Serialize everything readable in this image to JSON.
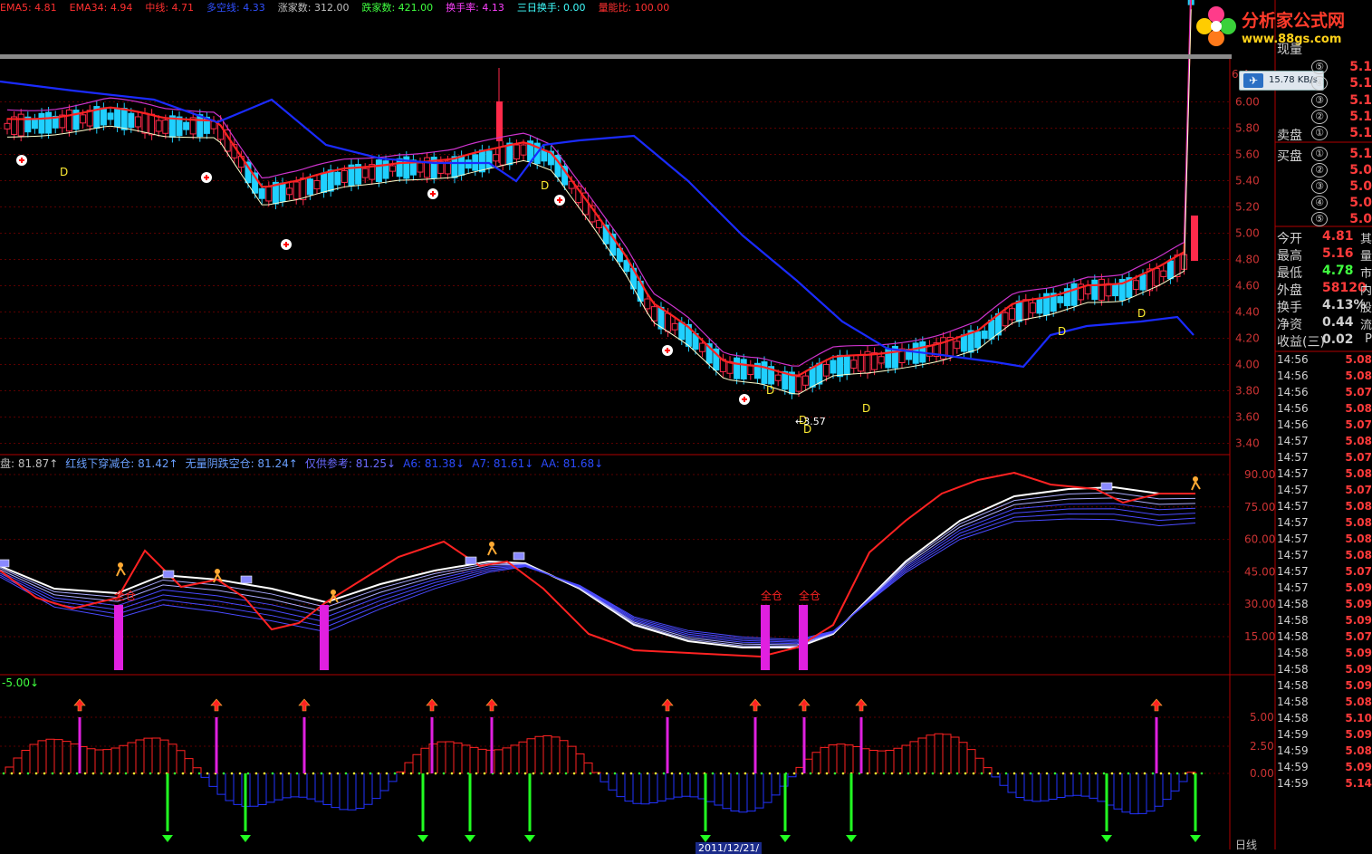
{
  "top_indicators": [
    {
      "text": "EMA5: 4.81",
      "color": "#ff3030"
    },
    {
      "text": "EMA34: 4.94",
      "color": "#ff3030"
    },
    {
      "text": "中线: 4.71",
      "color": "#ff3030"
    },
    {
      "text": "多空线: 4.33",
      "color": "#3050ff"
    },
    {
      "text": "涨家数: 312.00",
      "color": "#c0c0c0"
    },
    {
      "text": "跌家数: 421.00",
      "color": "#40ff40"
    },
    {
      "text": "换手率: 4.13",
      "color": "#ff40ff"
    },
    {
      "text": "三日换手: 0.00",
      "color": "#40ffff"
    },
    {
      "text": "量能比: 100.00",
      "color": "#ff3030"
    }
  ],
  "logo": {
    "name": "分析家公式网",
    "url": "www.88gs.com"
  },
  "speed_widget": {
    "text": "15.78 KB/s"
  },
  "price_axis": [
    "6.00",
    "5.80",
    "5.60",
    "5.40",
    "5.20",
    "5.00",
    "4.80",
    "4.60",
    "4.40",
    "4.20",
    "4.00",
    "3.80",
    "3.60",
    "3.40"
  ],
  "price_partial_label": "6.4",
  "low_label": "3.57",
  "d_marks": [
    "D",
    "D",
    "D",
    "D",
    "D",
    "D",
    "D",
    "D"
  ],
  "osc_legend": [
    {
      "text": "盘: 81.87↑",
      "color": "#c0c0c0"
    },
    {
      "text": "红线下穿减仓: 81.42↑",
      "color": "#6aa0ff"
    },
    {
      "text": "无量阴跌空仓: 81.24↑",
      "color": "#6aa0ff"
    },
    {
      "text": "仅供参考: 81.25↓",
      "color": "#6a6aff"
    },
    {
      "text": "A6: 81.38↓",
      "color": "#2b4bff"
    },
    {
      "text": "A7: 81.61↓",
      "color": "#2b4bff"
    },
    {
      "text": "AA: 81.68↓",
      "color": "#2b4bff"
    }
  ],
  "osc_axis": [
    "90.00",
    "75.00",
    "60.00",
    "45.00",
    "30.00",
    "15.00"
  ],
  "osc_bar_label": "全仓",
  "macd_label": "-5.00↓",
  "macd_axis": [
    "5.00",
    "2.50",
    "0.00"
  ],
  "date_label": "2011/12/21/",
  "bottom_label": "日线",
  "quote_panel": {
    "header": "现量",
    "sell_label": "卖盘",
    "buy_label": "买盘",
    "levels_sell": [
      "⑤",
      "④",
      "③",
      "②",
      "①"
    ],
    "levels_buy": [
      "①",
      "②",
      "③",
      "④",
      "⑤"
    ],
    "sell_vals": [
      "5.1",
      "5.1",
      "5.1",
      "5.1",
      "5.1"
    ],
    "buy_vals": [
      "5.1",
      "5.0",
      "5.0",
      "5.0",
      "5.0"
    ],
    "stats": [
      {
        "k": "今开",
        "v": "4.81",
        "c": "#ff3b3b",
        "x": "其"
      },
      {
        "k": "最高",
        "v": "5.16",
        "c": "#ff3b3b",
        "x": "量"
      },
      {
        "k": "最低",
        "v": "4.78",
        "c": "#40ff40",
        "x": "市"
      },
      {
        "k": "外盘",
        "v": "58120",
        "c": "#ff3b3b",
        "x": "内"
      },
      {
        "k": "换手",
        "v": "4.13%",
        "c": "#d0d0d0",
        "x": "股"
      },
      {
        "k": "净资",
        "v": "0.44",
        "c": "#d0d0d0",
        "x": "流"
      },
      {
        "k": "收益(三)",
        "v": "0.02",
        "c": "#d0d0d0",
        "x": "P"
      }
    ],
    "ticks": [
      {
        "t": "14:56",
        "v": "5.08"
      },
      {
        "t": "14:56",
        "v": "5.08"
      },
      {
        "t": "14:56",
        "v": "5.07"
      },
      {
        "t": "14:56",
        "v": "5.08"
      },
      {
        "t": "14:56",
        "v": "5.07"
      },
      {
        "t": "14:57",
        "v": "5.08"
      },
      {
        "t": "14:57",
        "v": "5.07"
      },
      {
        "t": "14:57",
        "v": "5.08"
      },
      {
        "t": "14:57",
        "v": "5.07"
      },
      {
        "t": "14:57",
        "v": "5.08"
      },
      {
        "t": "14:57",
        "v": "5.08"
      },
      {
        "t": "14:57",
        "v": "5.08"
      },
      {
        "t": "14:57",
        "v": "5.08"
      },
      {
        "t": "14:57",
        "v": "5.07"
      },
      {
        "t": "14:57",
        "v": "5.09"
      },
      {
        "t": "14:58",
        "v": "5.09"
      },
      {
        "t": "14:58",
        "v": "5.09"
      },
      {
        "t": "14:58",
        "v": "5.07"
      },
      {
        "t": "14:58",
        "v": "5.09"
      },
      {
        "t": "14:58",
        "v": "5.09"
      },
      {
        "t": "14:58",
        "v": "5.09"
      },
      {
        "t": "14:58",
        "v": "5.08"
      },
      {
        "t": "14:58",
        "v": "5.10"
      },
      {
        "t": "14:59",
        "v": "5.09"
      },
      {
        "t": "14:59",
        "v": "5.08"
      },
      {
        "t": "14:59",
        "v": "5.09"
      },
      {
        "t": "14:59",
        "v": "5.14"
      }
    ]
  }
}
